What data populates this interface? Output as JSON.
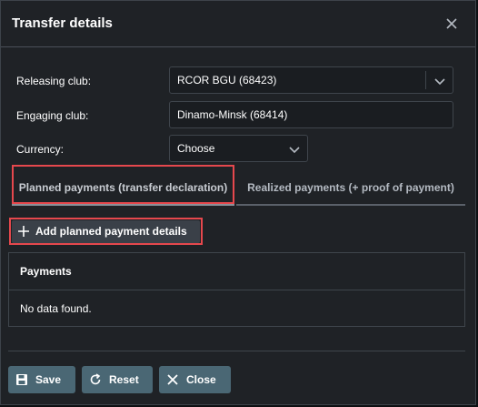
{
  "dialog": {
    "title": "Transfer details",
    "close_icon": "close-icon"
  },
  "form": {
    "releasing_club": {
      "label": "Releasing club:",
      "value": "RCOR BGU (68423)"
    },
    "engaging_club": {
      "label": "Engaging club:",
      "value": "Dinamo-Minsk (68414)"
    },
    "currency": {
      "label": "Currency:",
      "value": "Choose"
    }
  },
  "tabs": [
    {
      "label": "Planned payments (transfer declaration)",
      "active": true
    },
    {
      "label": "Realized payments (+ proof of payment)",
      "active": false
    }
  ],
  "planned": {
    "add_button_label": "Add planned payment details",
    "table_header": "Payments",
    "empty_text": "No data found."
  },
  "footer": {
    "save_label": "Save",
    "reset_label": "Reset",
    "close_label": "Close"
  },
  "colors": {
    "highlight": "#e5484d",
    "footer_button": "#4a6774",
    "add_button": "#3a4048"
  }
}
